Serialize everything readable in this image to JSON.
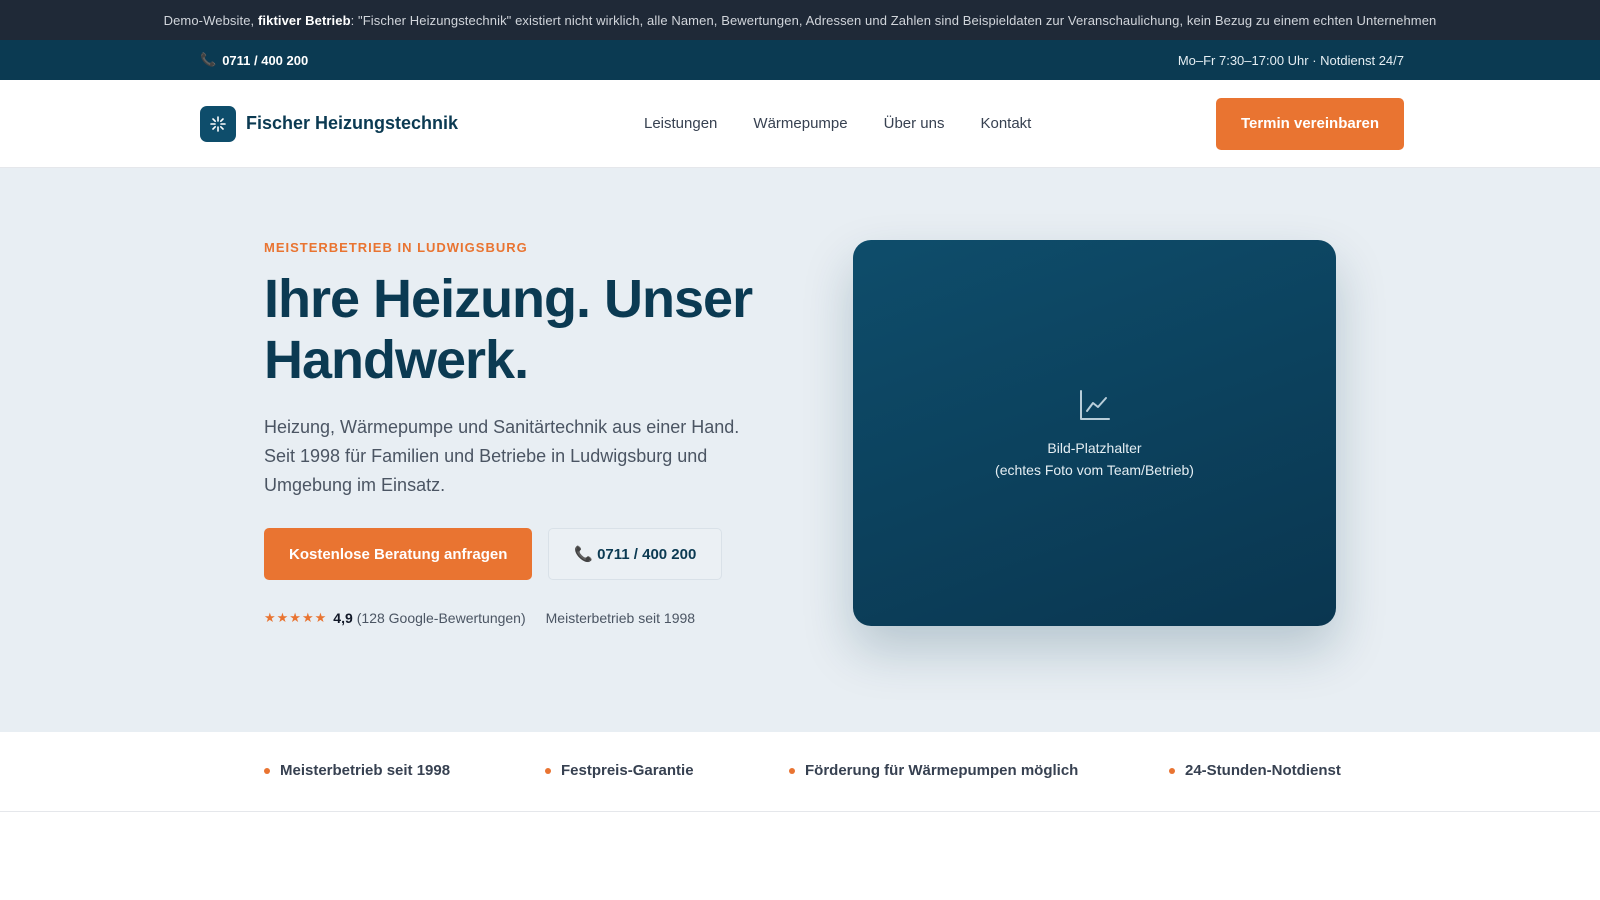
{
  "demo_notice": {
    "prefix": "Demo-Website, ",
    "bold": "fiktiver Betrieb",
    "suffix": ": \"Fischer Heizungstechnik\" existiert nicht wirklich, alle Namen, Bewertungen, Adressen und Zahlen sind Beispieldaten zur Veranschaulichung, kein Bezug zu einem echten Unternehmen"
  },
  "topbar": {
    "phone_icon": "phone-icon",
    "phone": "0711 / 400 200",
    "hours": "Mo–Fr 7:30–17:00 Uhr · Notdienst 24/7"
  },
  "header": {
    "logo_icon": "sun-flame-icon",
    "brand": "Fischer Heizungstechnik",
    "nav": [
      "Leistungen",
      "Wärmepumpe",
      "Über uns",
      "Kontakt"
    ],
    "cta": "Termin vereinbaren"
  },
  "hero": {
    "eyebrow": "MEISTERBETRIEB IN LUDWIGSBURG",
    "headline": "Ihre Heizung. Unser Handwerk.",
    "lead": "Heizung, Wärmepumpe und Sanitärtechnik aus einer Hand. Seit 1998 für Familien und Betriebe in Ludwigsburg und Umgebung im Einsatz.",
    "primary_button": "Kostenlose Beratung anfragen",
    "secondary_button": "0711 / 400 200",
    "stars": "★★★★★",
    "rating": "4,9",
    "reviews": "(128 Google-Bewertungen)",
    "since": "Meisterbetrieb seit 1998",
    "image_icon": "chart-line-icon",
    "image_title": "Bild-Platzhalter",
    "image_subtitle": "(echtes Foto vom Team/Betrieb)"
  },
  "features": [
    "Meisterbetrieb seit 1998",
    "Festpreis-Garantie",
    "Förderung für Wärmepumpen möglich",
    "24-Stunden-Notdienst"
  ],
  "colors": {
    "brand_dark": "#0b3a52",
    "accent": "#e97431",
    "hero_bg": "#e8eef3"
  }
}
